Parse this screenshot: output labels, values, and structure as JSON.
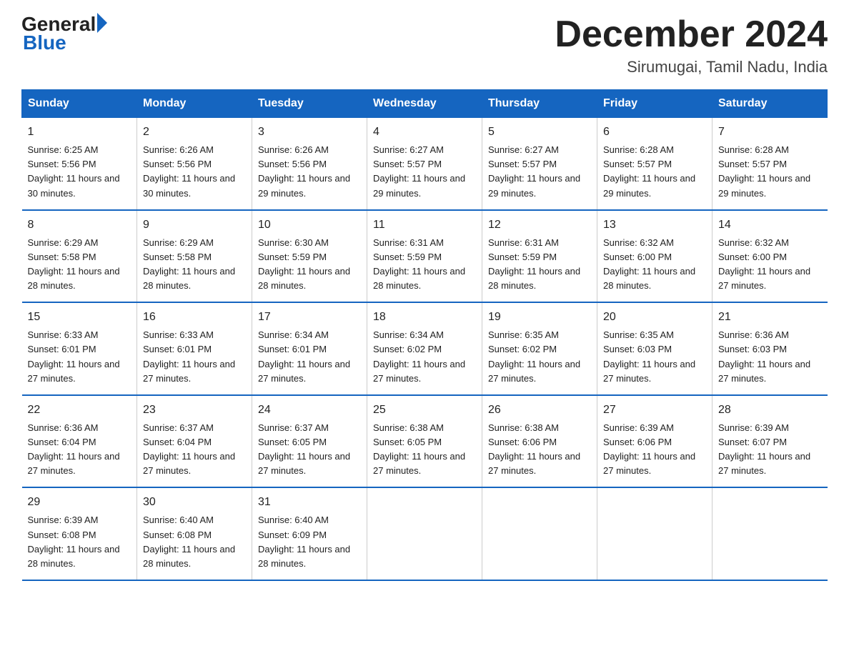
{
  "logo": {
    "general": "General",
    "arrow": "▶",
    "blue": "Blue"
  },
  "title": "December 2024",
  "subtitle": "Sirumugai, Tamil Nadu, India",
  "headers": [
    "Sunday",
    "Monday",
    "Tuesday",
    "Wednesday",
    "Thursday",
    "Friday",
    "Saturday"
  ],
  "weeks": [
    [
      {
        "day": "1",
        "sunrise": "6:25 AM",
        "sunset": "5:56 PM",
        "daylight": "11 hours and 30 minutes."
      },
      {
        "day": "2",
        "sunrise": "6:26 AM",
        "sunset": "5:56 PM",
        "daylight": "11 hours and 30 minutes."
      },
      {
        "day": "3",
        "sunrise": "6:26 AM",
        "sunset": "5:56 PM",
        "daylight": "11 hours and 29 minutes."
      },
      {
        "day": "4",
        "sunrise": "6:27 AM",
        "sunset": "5:57 PM",
        "daylight": "11 hours and 29 minutes."
      },
      {
        "day": "5",
        "sunrise": "6:27 AM",
        "sunset": "5:57 PM",
        "daylight": "11 hours and 29 minutes."
      },
      {
        "day": "6",
        "sunrise": "6:28 AM",
        "sunset": "5:57 PM",
        "daylight": "11 hours and 29 minutes."
      },
      {
        "day": "7",
        "sunrise": "6:28 AM",
        "sunset": "5:57 PM",
        "daylight": "11 hours and 29 minutes."
      }
    ],
    [
      {
        "day": "8",
        "sunrise": "6:29 AM",
        "sunset": "5:58 PM",
        "daylight": "11 hours and 28 minutes."
      },
      {
        "day": "9",
        "sunrise": "6:29 AM",
        "sunset": "5:58 PM",
        "daylight": "11 hours and 28 minutes."
      },
      {
        "day": "10",
        "sunrise": "6:30 AM",
        "sunset": "5:59 PM",
        "daylight": "11 hours and 28 minutes."
      },
      {
        "day": "11",
        "sunrise": "6:31 AM",
        "sunset": "5:59 PM",
        "daylight": "11 hours and 28 minutes."
      },
      {
        "day": "12",
        "sunrise": "6:31 AM",
        "sunset": "5:59 PM",
        "daylight": "11 hours and 28 minutes."
      },
      {
        "day": "13",
        "sunrise": "6:32 AM",
        "sunset": "6:00 PM",
        "daylight": "11 hours and 28 minutes."
      },
      {
        "day": "14",
        "sunrise": "6:32 AM",
        "sunset": "6:00 PM",
        "daylight": "11 hours and 27 minutes."
      }
    ],
    [
      {
        "day": "15",
        "sunrise": "6:33 AM",
        "sunset": "6:01 PM",
        "daylight": "11 hours and 27 minutes."
      },
      {
        "day": "16",
        "sunrise": "6:33 AM",
        "sunset": "6:01 PM",
        "daylight": "11 hours and 27 minutes."
      },
      {
        "day": "17",
        "sunrise": "6:34 AM",
        "sunset": "6:01 PM",
        "daylight": "11 hours and 27 minutes."
      },
      {
        "day": "18",
        "sunrise": "6:34 AM",
        "sunset": "6:02 PM",
        "daylight": "11 hours and 27 minutes."
      },
      {
        "day": "19",
        "sunrise": "6:35 AM",
        "sunset": "6:02 PM",
        "daylight": "11 hours and 27 minutes."
      },
      {
        "day": "20",
        "sunrise": "6:35 AM",
        "sunset": "6:03 PM",
        "daylight": "11 hours and 27 minutes."
      },
      {
        "day": "21",
        "sunrise": "6:36 AM",
        "sunset": "6:03 PM",
        "daylight": "11 hours and 27 minutes."
      }
    ],
    [
      {
        "day": "22",
        "sunrise": "6:36 AM",
        "sunset": "6:04 PM",
        "daylight": "11 hours and 27 minutes."
      },
      {
        "day": "23",
        "sunrise": "6:37 AM",
        "sunset": "6:04 PM",
        "daylight": "11 hours and 27 minutes."
      },
      {
        "day": "24",
        "sunrise": "6:37 AM",
        "sunset": "6:05 PM",
        "daylight": "11 hours and 27 minutes."
      },
      {
        "day": "25",
        "sunrise": "6:38 AM",
        "sunset": "6:05 PM",
        "daylight": "11 hours and 27 minutes."
      },
      {
        "day": "26",
        "sunrise": "6:38 AM",
        "sunset": "6:06 PM",
        "daylight": "11 hours and 27 minutes."
      },
      {
        "day": "27",
        "sunrise": "6:39 AM",
        "sunset": "6:06 PM",
        "daylight": "11 hours and 27 minutes."
      },
      {
        "day": "28",
        "sunrise": "6:39 AM",
        "sunset": "6:07 PM",
        "daylight": "11 hours and 27 minutes."
      }
    ],
    [
      {
        "day": "29",
        "sunrise": "6:39 AM",
        "sunset": "6:08 PM",
        "daylight": "11 hours and 28 minutes."
      },
      {
        "day": "30",
        "sunrise": "6:40 AM",
        "sunset": "6:08 PM",
        "daylight": "11 hours and 28 minutes."
      },
      {
        "day": "31",
        "sunrise": "6:40 AM",
        "sunset": "6:09 PM",
        "daylight": "11 hours and 28 minutes."
      },
      null,
      null,
      null,
      null
    ]
  ]
}
